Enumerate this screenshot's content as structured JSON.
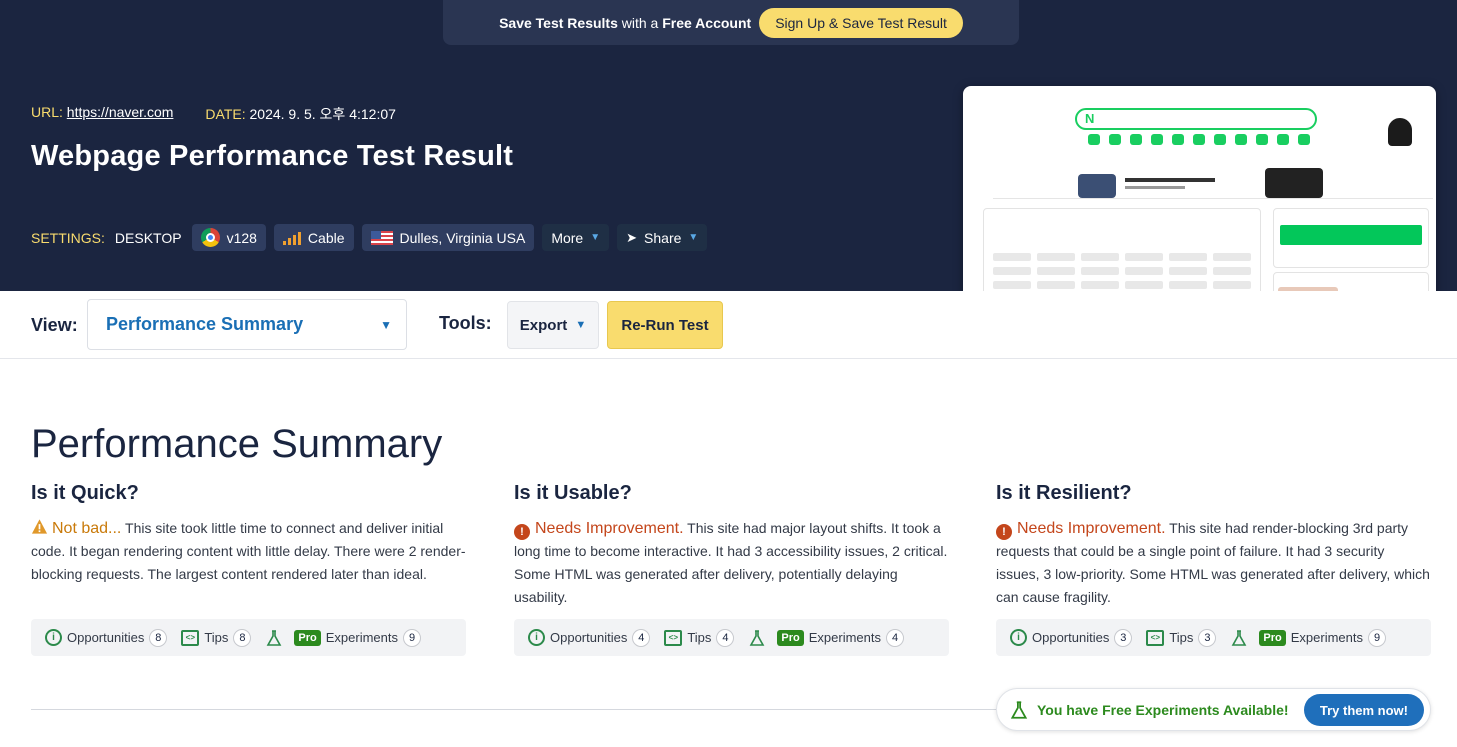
{
  "banner": {
    "bold1": "Save Test Results",
    "middle": " with a ",
    "bold2": "Free Account",
    "button": "Sign Up & Save Test Result"
  },
  "meta": {
    "url_label": "URL:",
    "url": "https://naver.com",
    "date_label": "DATE:",
    "date": "2024. 9. 5. 오후 4:12:07"
  },
  "page_title": "Webpage Performance Test Result",
  "settings": {
    "label": "SETTINGS:",
    "device": "DESKTOP",
    "browser": "v128",
    "connection": "Cable",
    "location": "Dulles, Virginia USA",
    "more": "More",
    "share": "Share"
  },
  "toolbar": {
    "view_label": "View:",
    "view_value": "Performance Summary",
    "tools_label": "Tools:",
    "export": "Export",
    "rerun": "Re-Run Test"
  },
  "summary": {
    "title": "Performance Summary",
    "columns": [
      {
        "heading": "Is it Quick?",
        "grade": "Not bad...",
        "grade_type": "warning",
        "text": " This site took little time to connect and deliver initial code. It began rendering content with little delay. There were 2 render-blocking requests. The largest content rendered later than ideal.",
        "opportunities_label": "Opportunities",
        "opportunities": "8",
        "tips_label": "Tips",
        "tips": "8",
        "pro_label": "Pro",
        "experiments_label": "Experiments",
        "experiments": "9"
      },
      {
        "heading": "Is it Usable?",
        "grade": "Needs Improvement.",
        "grade_type": "error",
        "text": " This site had major layout shifts. It took a long time to become interactive. It had 3 accessibility issues, 2 critical. Some HTML was generated after delivery, potentially delaying usability.",
        "opportunities_label": "Opportunities",
        "opportunities": "4",
        "tips_label": "Tips",
        "tips": "4",
        "pro_label": "Pro",
        "experiments_label": "Experiments",
        "experiments": "4"
      },
      {
        "heading": "Is it Resilient?",
        "grade": "Needs Improvement.",
        "grade_type": "error",
        "text": " This site had render-blocking 3rd party requests that could be a single point of failure. It had 3 security issues, 3 low-priority. Some HTML was generated after delivery, which can cause fragility.",
        "opportunities_label": "Opportunities",
        "opportunities": "3",
        "tips_label": "Tips",
        "tips": "3",
        "pro_label": "Pro",
        "experiments_label": "Experiments",
        "experiments": "9"
      }
    ]
  },
  "experiments_bar": {
    "text": "You have Free Experiments Available!",
    "button": "Try them now!"
  },
  "colors": {
    "hero_bg": "#1b2540",
    "accent_yellow": "#f9dc6e",
    "link_blue": "#1a6fb5",
    "warning": "#c97a0a",
    "error": "#c4461b",
    "pro_green": "#2c8a1e"
  }
}
